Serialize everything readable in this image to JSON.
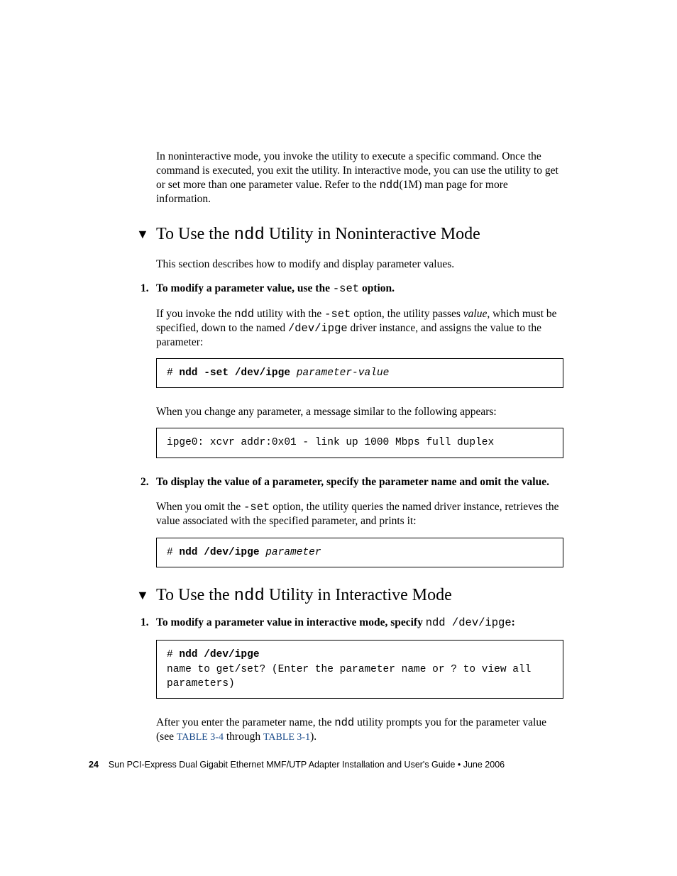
{
  "intro": {
    "p1_a": "In noninteractive mode, you invoke the utility to execute a specific command. Once the command is executed, you exit the utility. In interactive mode, you can use the utility to get or set more than one parameter value. Refer to the ",
    "p1_mono": "ndd",
    "p1_b": "(1M) man page for more information."
  },
  "section1": {
    "title_a": "To Use the ",
    "title_mono": "ndd",
    "title_b": " Utility in Noninteractive Mode",
    "desc": "This section describes how to modify and display parameter values.",
    "step1": {
      "num": "1.",
      "text_a": "To modify a parameter value, use the ",
      "text_mono": "-set",
      "text_b": " option.",
      "body_a": "If you invoke the ",
      "body_mono1": "ndd",
      "body_b": " utility with the ",
      "body_mono2": "-set",
      "body_c": " option, the utility passes ",
      "body_italic": "value",
      "body_d": ", which must be specified, down to the named ",
      "body_mono3": "/dev/ipge",
      "body_e": " driver instance, and assigns the value to the parameter:",
      "code_prefix": "# ",
      "code_bold": "ndd -set /dev/ipge",
      "code_italic": " parameter-value",
      "after": "When you change any parameter, a message similar to the following appears:",
      "code2": "ipge0: xcvr addr:0x01 - link up 1000 Mbps full duplex"
    },
    "step2": {
      "num": "2.",
      "text": "To display the value of a parameter, specify the parameter name and omit the value.",
      "body_a": "When you omit the ",
      "body_mono": "-set",
      "body_b": " option, the utility queries the named driver instance, retrieves the value associated with the specified parameter, and prints it:",
      "code_prefix": "# ",
      "code_bold": "ndd /dev/ipge",
      "code_italic": " parameter"
    }
  },
  "section2": {
    "title_a": "To Use the ",
    "title_mono": "ndd",
    "title_b": " Utility in Interactive Mode",
    "step1": {
      "num": "1.",
      "text_a": "To modify a parameter value in interactive mode, specify ",
      "text_mono": "ndd /dev/ipge",
      "text_b": ":",
      "code_prefix": "# ",
      "code_bold": "ndd /dev/ipge",
      "code_line2": "name to get/set? (Enter the parameter name or ? to view all parameters)",
      "after_a": "After you enter the parameter name, the ",
      "after_mono": "ndd",
      "after_b": " utility prompts you for the parameter value (see ",
      "link1": "TABLE 3-4",
      "after_c": " through ",
      "link2": "TABLE 3-1",
      "after_d": ")."
    }
  },
  "footer": {
    "pagenum": "24",
    "text": "Sun PCI-Express Dual Gigabit Ethernet MMF/UTP Adapter Installation and User's Guide • June 2006"
  }
}
